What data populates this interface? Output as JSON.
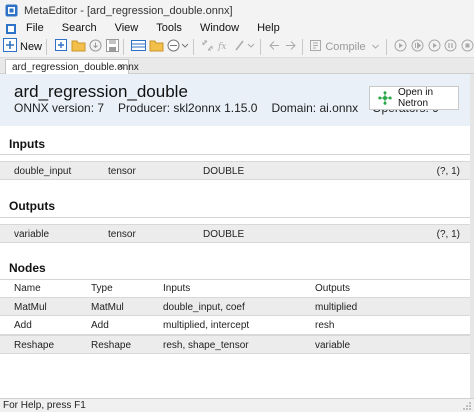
{
  "window": {
    "title": "MetaEditor - [ard_regression_double.onnx]"
  },
  "menu": {
    "items": [
      "File",
      "Search",
      "View",
      "Tools",
      "Window",
      "Help"
    ]
  },
  "toolbar": {
    "new_label": "New",
    "compile_label": "Compile"
  },
  "tab": {
    "label": "ard_regression_double.onnx",
    "close": "×"
  },
  "model": {
    "name": "ard_regression_double",
    "onnx_version": "ONNX version: 7",
    "producer": "Producer: skl2onnx 1.15.0",
    "domain": "Domain: ai.onnx",
    "operators": "Operators: 9",
    "open_in_netron": "Open in Netron"
  },
  "inputs": {
    "title": "Inputs",
    "rows": [
      {
        "name": "double_input",
        "kind": "tensor",
        "type": "DOUBLE",
        "shape": "(?, 1)"
      }
    ]
  },
  "outputs": {
    "title": "Outputs",
    "rows": [
      {
        "name": "variable",
        "kind": "tensor",
        "type": "DOUBLE",
        "shape": "(?, 1)"
      }
    ]
  },
  "nodes": {
    "title": "Nodes",
    "columns": [
      "Name",
      "Type",
      "Inputs",
      "Outputs"
    ],
    "rows": [
      {
        "name": "MatMul",
        "type": "MatMul",
        "inputs": "double_input, coef",
        "outputs": "multiplied"
      },
      {
        "name": "Add",
        "type": "Add",
        "inputs": "multiplied, intercept",
        "outputs": "resh"
      },
      {
        "name": "Reshape",
        "type": "Reshape",
        "inputs": "resh, shape_tensor",
        "outputs": "variable"
      }
    ]
  },
  "status": {
    "text": "For Help, press F1"
  },
  "icons": {
    "app": "metaeditor-logo-icon",
    "netron": "netron-graph-icon"
  },
  "colors": {
    "accent": "#1f6fd6",
    "header_bg": "#e9f0f8",
    "row_bg": "#ececec"
  }
}
